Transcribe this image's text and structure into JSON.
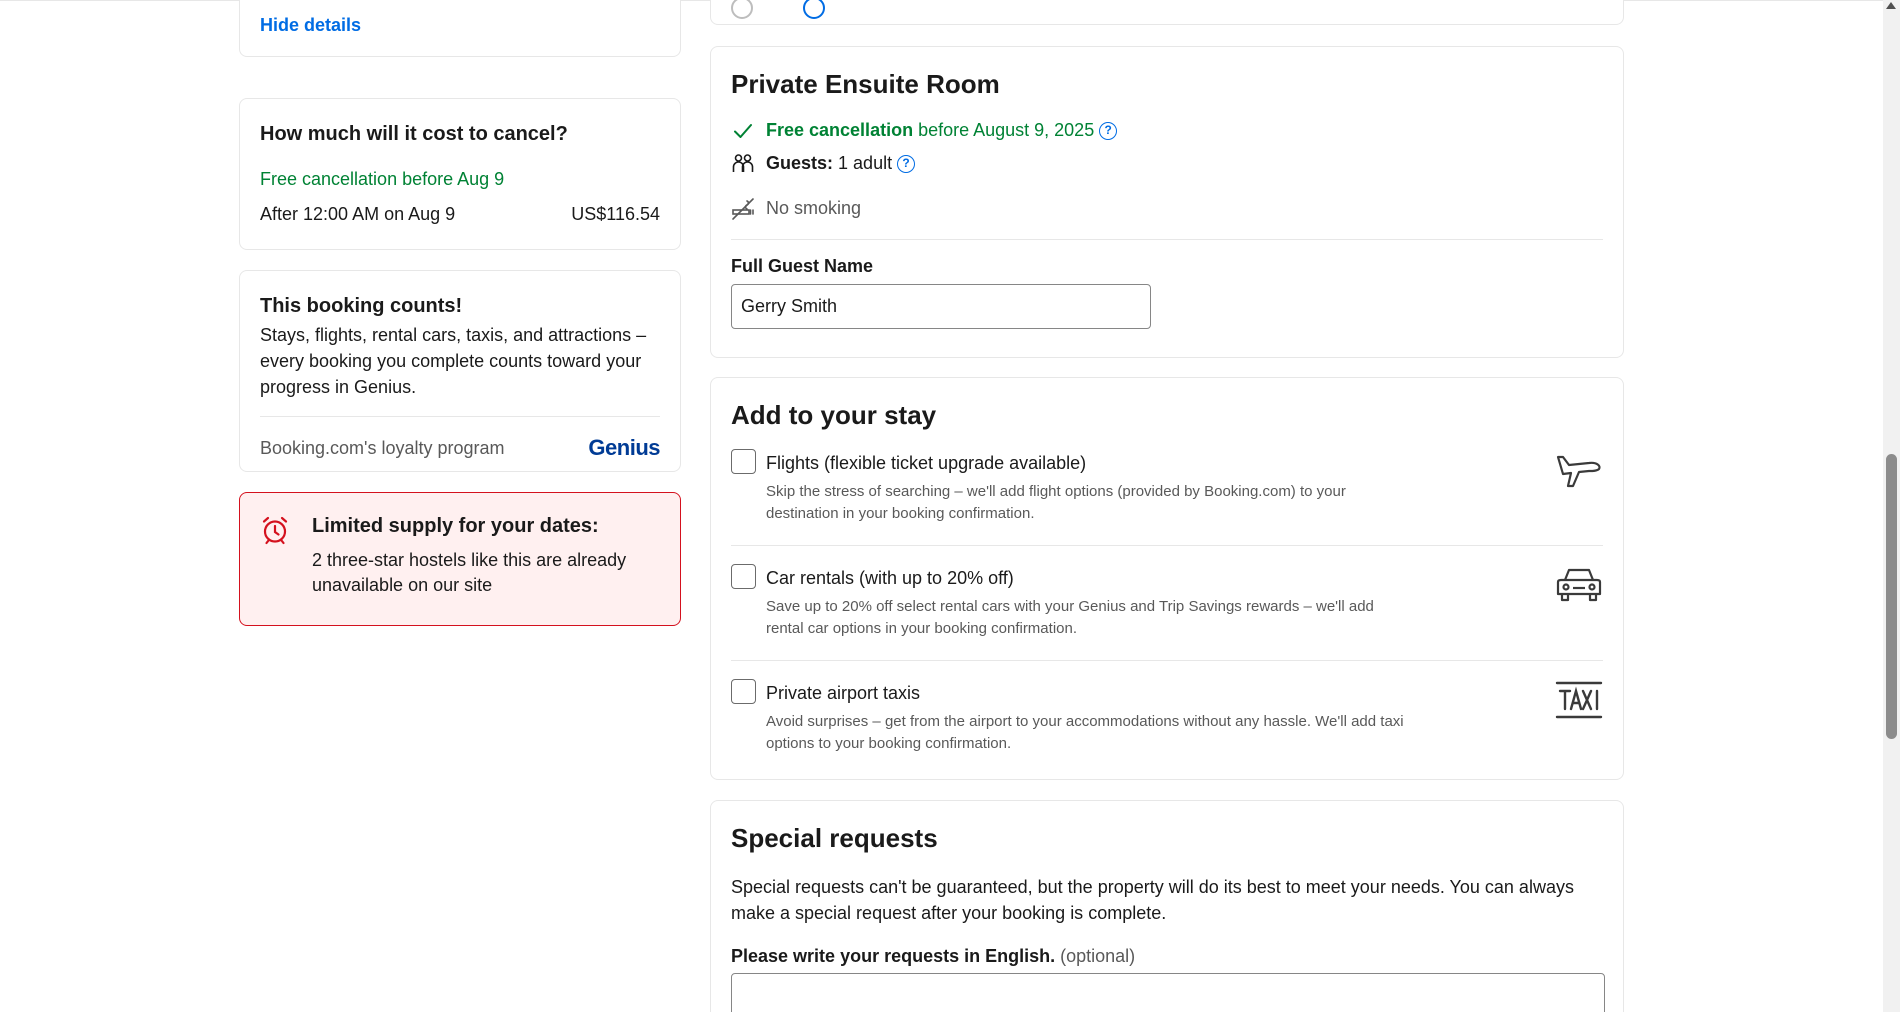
{
  "left": {
    "hide_details": "Hide details",
    "cancel": {
      "title": "How much will it cost to cancel?",
      "free": "Free cancellation before Aug 9",
      "after_label": "After 12:00 AM on Aug 9",
      "after_price": "US$116.54"
    },
    "genius": {
      "title": "This booking counts!",
      "body": "Stays, flights, rental cars, taxis, and attractions – every booking you complete counts toward your progress in Genius.",
      "footer": "Booking.com's loyalty program",
      "logo": "Genius"
    },
    "limited": {
      "title": "Limited supply for your dates:",
      "body": "2 three-star hostels like this are already unavailable on our site",
      "icon": "alarm-clock-icon"
    }
  },
  "room": {
    "title": "Private Ensuite Room",
    "free_cancel_bold": "Free cancellation",
    "free_cancel_rest": "before August 9, 2025",
    "guests_label": "Guests:",
    "guests_value": "1 adult",
    "no_smoking": "No smoking",
    "name_label": "Full Guest Name",
    "name_value": "Gerry Smith"
  },
  "add_to_stay": {
    "title": "Add to your stay",
    "options": [
      {
        "label": "Flights (flexible ticket upgrade available)",
        "desc": "Skip the stress of searching – we'll add flight options (provided by Booking.com) to your destination in your booking confirmation.",
        "icon": "airplane-icon"
      },
      {
        "label": "Car rentals (with up to 20% off)",
        "desc": "Save up to 20% off select rental cars with your Genius and Trip Savings rewards – we'll add rental car options in your booking confirmation.",
        "icon": "car-icon"
      },
      {
        "label": "Private airport taxis",
        "desc": "Avoid surprises – get from the airport to your accommodations without any hassle. We'll add taxi options to your booking confirmation.",
        "icon": "taxi-icon"
      }
    ]
  },
  "special": {
    "title": "Special requests",
    "body": "Special requests can't be guaranteed, but the property will do its best to meet your needs. You can always make a special request after your booking is complete.",
    "label": "Please write your requests in English.",
    "optional": "(optional)"
  },
  "colors": {
    "link_blue": "#006ce4",
    "green": "#008234",
    "alert_red": "#d4111e",
    "alert_bg": "#fff0f0",
    "genius_navy": "#003b95"
  }
}
